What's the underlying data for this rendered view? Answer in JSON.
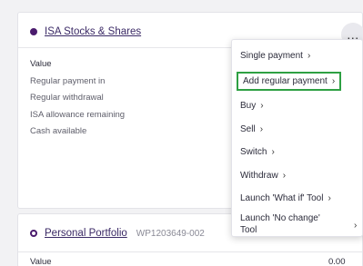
{
  "account1": {
    "name": "ISA Stocks & Shares",
    "rows": [
      "Value",
      "Regular payment in",
      "Regular withdrawal",
      "ISA allowance remaining",
      "Cash available"
    ],
    "more_label": "…"
  },
  "menu": {
    "items": [
      "Single payment",
      "Add regular payment",
      "Buy",
      "Sell",
      "Switch",
      "Withdraw",
      "Launch 'What if' Tool",
      "Launch 'No change' Tool"
    ],
    "chevron": "›",
    "highlighted_item": "Add regular payment"
  },
  "account2": {
    "name": "Personal Portfolio",
    "reference": "WP1203649-002",
    "value_label": "Value",
    "value": "0.00"
  },
  "colors": {
    "highlight_border": "#2ea043",
    "brand_purple": "#4a1b6d"
  }
}
